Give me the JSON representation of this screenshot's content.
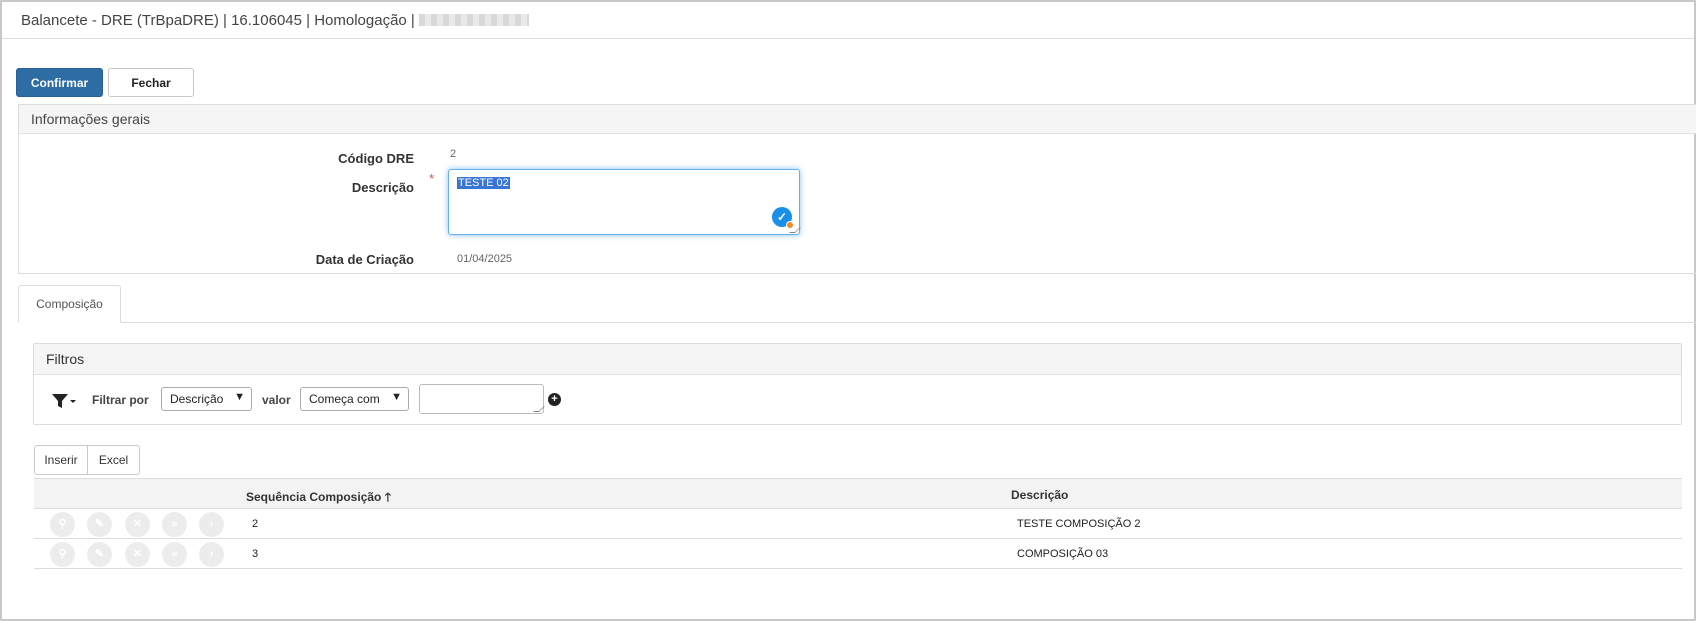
{
  "window": {
    "title": "Balancete - DRE (TrBpaDRE) | 16.106045 | Homologação |"
  },
  "toolbar": {
    "confirm_label": "Confirmar",
    "close_label": "Fechar"
  },
  "general_info": {
    "header": "Informações gerais",
    "codigo_label": "Código DRE",
    "codigo_value": "2",
    "descricao_label": "Descrição",
    "descricao_required": "*",
    "descricao_value": "TESTE 02",
    "data_label": "Data de Criação",
    "data_value": "01/04/2025"
  },
  "tabs": [
    {
      "label": "Composição",
      "active": true
    }
  ],
  "filters": {
    "header": "Filtros",
    "filter_by_label": "Filtrar por",
    "field_selected": "Descrição",
    "value_label": "valor",
    "operator_selected": "Começa com",
    "value_input": ""
  },
  "grid_toolbar": {
    "insert_label": "Inserir",
    "excel_label": "Excel"
  },
  "grid": {
    "columns": [
      "Sequência Composição",
      "Descrição"
    ],
    "sort_indicator": "🡑",
    "rows": [
      {
        "sequencia": "2",
        "descricao": "TESTE COMPOSIÇÃO 2"
      },
      {
        "sequencia": "3",
        "descricao": "COMPOSIÇÃO 03"
      }
    ],
    "row_actions": [
      "view-icon",
      "edit-icon",
      "delete-icon",
      "fast-forward-icon",
      "next-icon"
    ]
  },
  "colors": {
    "primary": "#2e6da4",
    "focus": "#66afe9",
    "required": "#d9534f"
  }
}
